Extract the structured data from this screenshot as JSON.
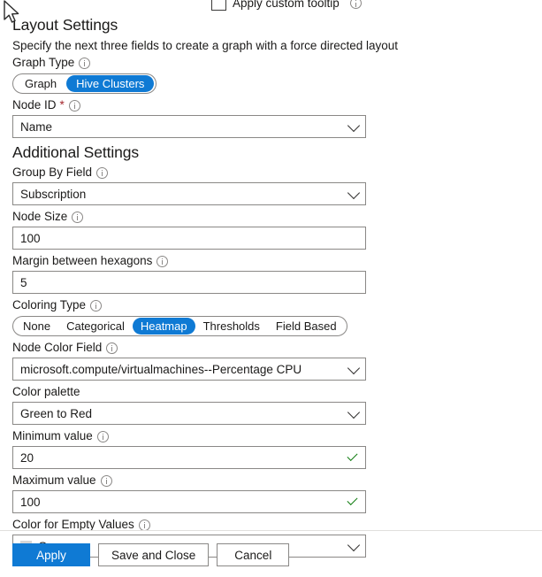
{
  "top": {
    "checkbox_label": "Apply custom tooltip",
    "checkbox_checked": false
  },
  "layout_settings": {
    "heading": "Layout Settings",
    "description": "Specify the next three fields to create a graph with a force directed layout",
    "graph_type": {
      "label": "Graph Type",
      "options": [
        "Graph",
        "Hive Clusters"
      ],
      "selected": "Hive Clusters"
    },
    "node_id": {
      "label": "Node ID",
      "required_mark": "*",
      "value": "Name"
    }
  },
  "additional_settings": {
    "heading": "Additional Settings",
    "group_by_field": {
      "label": "Group By Field",
      "value": "Subscription"
    },
    "node_size": {
      "label": "Node Size",
      "value": "100"
    },
    "margin_between_hexagons": {
      "label": "Margin between hexagons",
      "value": "5"
    },
    "coloring_type": {
      "label": "Coloring Type",
      "options": [
        "None",
        "Categorical",
        "Heatmap",
        "Thresholds",
        "Field Based"
      ],
      "selected": "Heatmap"
    },
    "node_color_field": {
      "label": "Node Color Field",
      "value": "microsoft.compute/virtualmachines--Percentage CPU"
    },
    "color_palette": {
      "label": "Color palette",
      "value": "Green to Red"
    },
    "minimum_value": {
      "label": "Minimum value",
      "value": "20",
      "valid": true
    },
    "maximum_value": {
      "label": "Maximum value",
      "value": "100",
      "valid": true
    },
    "color_for_empty_values": {
      "label": "Color for Empty Values",
      "value": "Gray",
      "swatch_color": "#d6d6d6"
    }
  },
  "footer": {
    "apply": "Apply",
    "save_and_close": "Save and Close",
    "cancel": "Cancel"
  },
  "colors": {
    "accent": "#0f7ad4",
    "required": "#a4262c",
    "valid": "#107c10",
    "border": "#8a8886"
  }
}
